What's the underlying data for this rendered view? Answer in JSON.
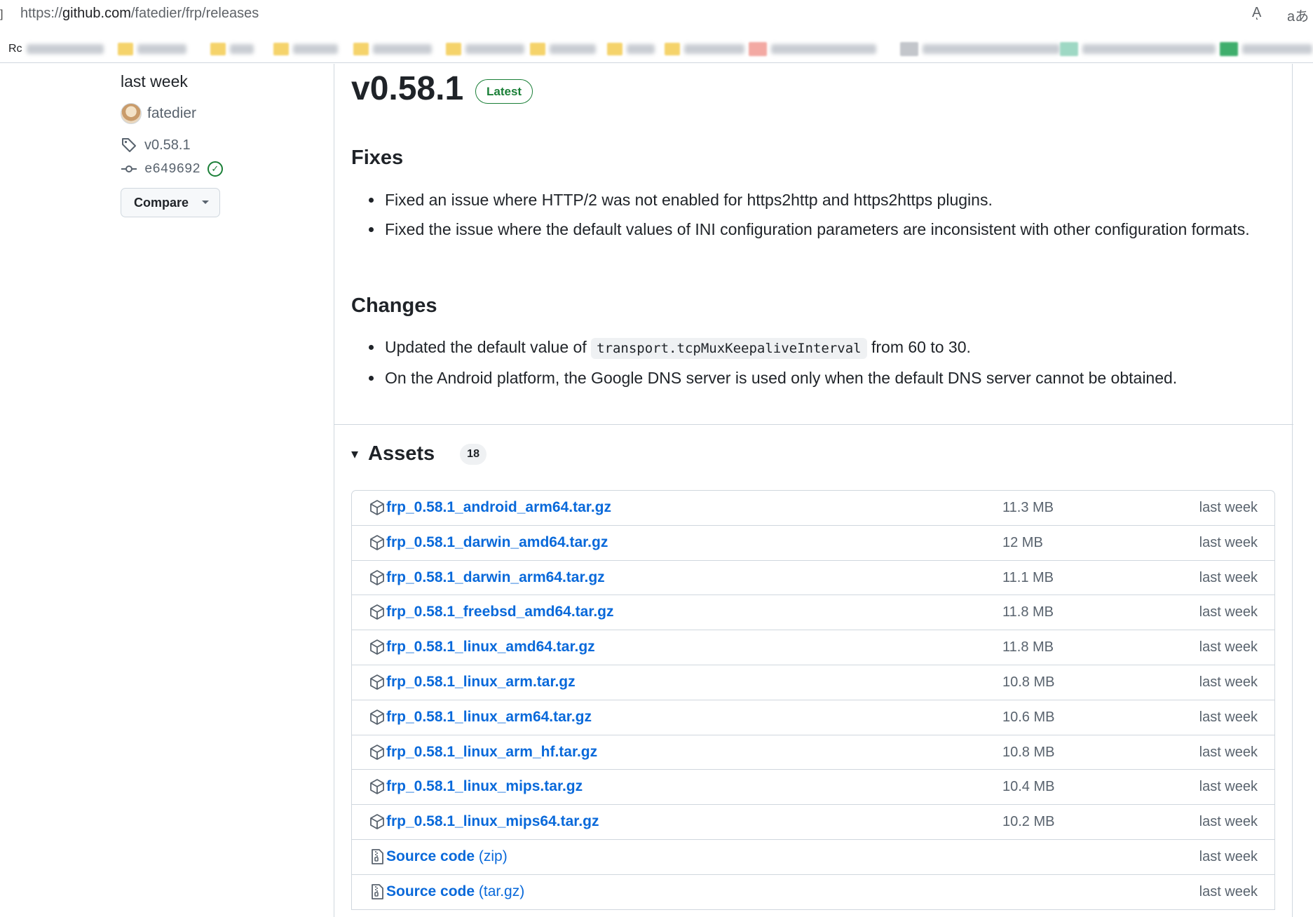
{
  "browser": {
    "url_prefix": "https://",
    "url_host": "github.com",
    "url_path": "/fatedier/frp/releases",
    "read_aloud_icon": "Aͅ",
    "translate_icon": "aあ",
    "bookmarks": [
      {
        "label": "Rc"
      },
      {
        "label": "Python"
      },
      {
        "label": "Docker"
      },
      {
        "label": "Git"
      }
    ]
  },
  "sidebar": {
    "release_time": "last week",
    "author": "fatedier",
    "tag": "v0.58.1",
    "commit": "e649692",
    "compare_label": "Compare"
  },
  "release": {
    "title": "v0.58.1",
    "badge": "Latest",
    "fixes_heading": "Fixes",
    "fixes": [
      "Fixed an issue where HTTP/2 was not enabled for https2http and https2https plugins.",
      "Fixed the issue where the default values of INI configuration parameters are inconsistent with other configuration formats."
    ],
    "changes_heading": "Changes",
    "change1_before": "Updated the default value of ",
    "change1_code": "transport.tcpMuxKeepaliveInterval",
    "change1_after": " from 60 to 30.",
    "change2": "On the Android platform, the Google DNS server is used only when the default DNS server cannot be obtained."
  },
  "assets": {
    "toggle": "▾",
    "title": "Assets",
    "count": "18",
    "rows": [
      {
        "name": "frp_0.58.1_android_arm64.tar.gz",
        "suffix": "",
        "size": "11.3 MB",
        "date": "last week",
        "icon": "package"
      },
      {
        "name": "frp_0.58.1_darwin_amd64.tar.gz",
        "suffix": "",
        "size": "12 MB",
        "date": "last week",
        "icon": "package"
      },
      {
        "name": "frp_0.58.1_darwin_arm64.tar.gz",
        "suffix": "",
        "size": "11.1 MB",
        "date": "last week",
        "icon": "package"
      },
      {
        "name": "frp_0.58.1_freebsd_amd64.tar.gz",
        "suffix": "",
        "size": "11.8 MB",
        "date": "last week",
        "icon": "package"
      },
      {
        "name": "frp_0.58.1_linux_amd64.tar.gz",
        "suffix": "",
        "size": "11.8 MB",
        "date": "last week",
        "icon": "package"
      },
      {
        "name": "frp_0.58.1_linux_arm.tar.gz",
        "suffix": "",
        "size": "10.8 MB",
        "date": "last week",
        "icon": "package"
      },
      {
        "name": "frp_0.58.1_linux_arm64.tar.gz",
        "suffix": "",
        "size": "10.6 MB",
        "date": "last week",
        "icon": "package"
      },
      {
        "name": "frp_0.58.1_linux_arm_hf.tar.gz",
        "suffix": "",
        "size": "10.8 MB",
        "date": "last week",
        "icon": "package"
      },
      {
        "name": "frp_0.58.1_linux_mips.tar.gz",
        "suffix": "",
        "size": "10.4 MB",
        "date": "last week",
        "icon": "package"
      },
      {
        "name": "frp_0.58.1_linux_mips64.tar.gz",
        "suffix": "",
        "size": "10.2 MB",
        "date": "last week",
        "icon": "package"
      },
      {
        "name": "Source code",
        "suffix": " (zip)",
        "size": "",
        "date": "last week",
        "icon": "file-zip"
      },
      {
        "name": "Source code",
        "suffix": " (tar.gz)",
        "size": "",
        "date": "last week",
        "icon": "file-zip"
      }
    ]
  }
}
